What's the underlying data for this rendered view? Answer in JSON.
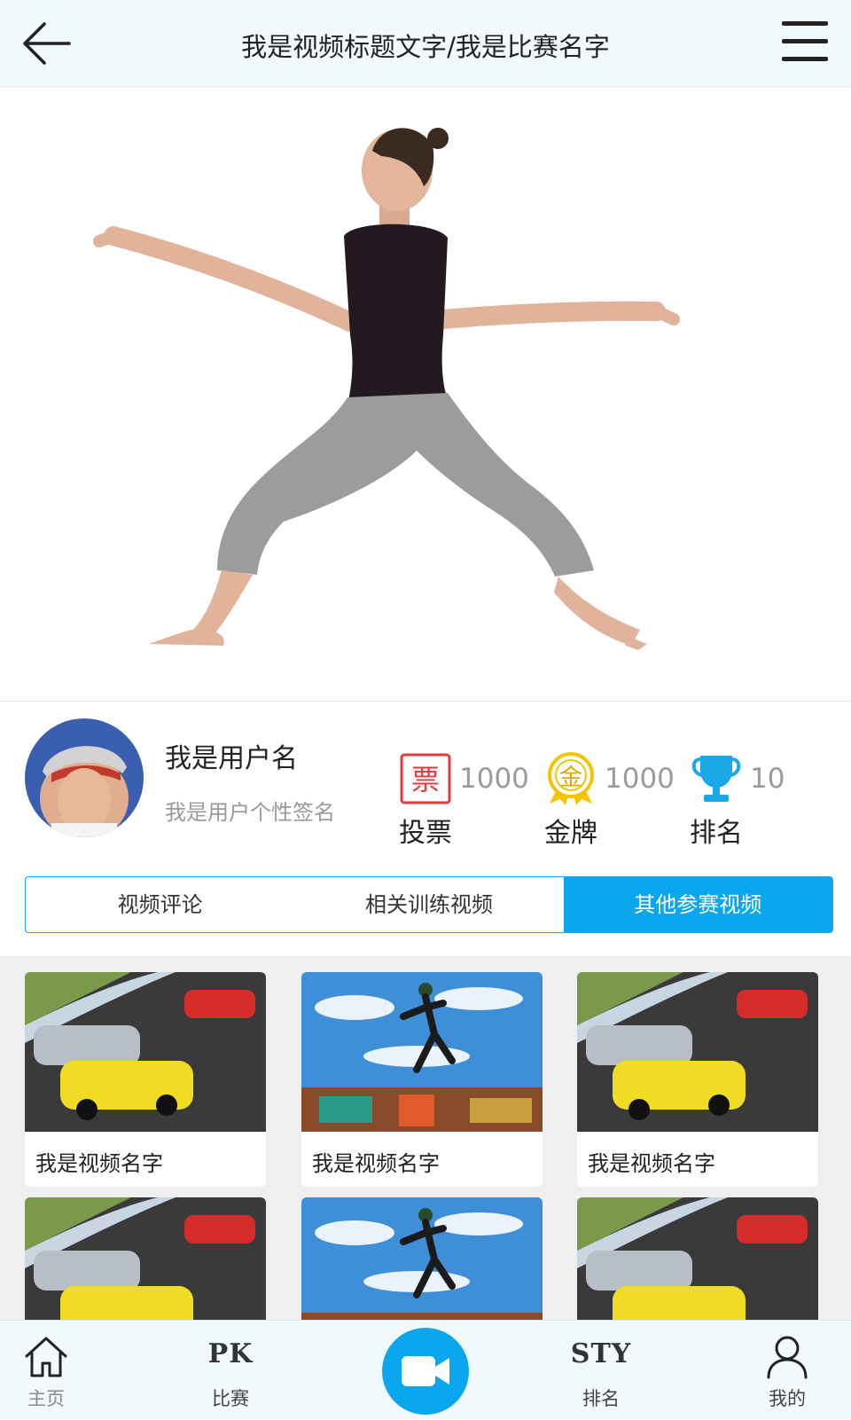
{
  "header": {
    "title": "我是视频标题文字/我是比赛名字",
    "back_icon": "arrow-left-icon",
    "menu_icon": "hamburger-menu-icon"
  },
  "user": {
    "name": "我是用户名",
    "signature": "我是用户个性签名"
  },
  "stats": [
    {
      "icon": "ticket-icon",
      "icon_text": "票",
      "value": "1000",
      "label": "投票",
      "color": "#e33b3b"
    },
    {
      "icon": "gold-medal-icon",
      "icon_text": "金",
      "value": "1000",
      "label": "金牌",
      "color": "#f5c400"
    },
    {
      "icon": "trophy-icon",
      "value": "10",
      "label": "排名",
      "color": "#1aa7e8"
    }
  ],
  "tabs": [
    {
      "label": "视频评论",
      "active": false
    },
    {
      "label": "相关训练视频",
      "active": false
    },
    {
      "label": "其他参赛视频",
      "active": true
    }
  ],
  "videos": [
    {
      "title": "我是视频名字",
      "thumb": "racing-cars"
    },
    {
      "title": "我是视频名字",
      "thumb": "street-dancer"
    },
    {
      "title": "我是视频名字",
      "thumb": "racing-cars"
    },
    {
      "title": "",
      "thumb": "racing-cars"
    },
    {
      "title": "",
      "thumb": "street-dancer"
    },
    {
      "title": "",
      "thumb": "racing-cars"
    }
  ],
  "nav": {
    "home": {
      "label": "主页",
      "icon": "home-icon"
    },
    "pk": {
      "big": "PK",
      "label": "比赛"
    },
    "record": {
      "icon": "video-camera-icon"
    },
    "sty": {
      "big": "STY",
      "label": "排名"
    },
    "mine": {
      "label": "我的",
      "icon": "user-icon"
    }
  },
  "colors": {
    "accent": "#0aa6ee",
    "header_bg": "#f1f9fd",
    "grid_bg": "#efefef"
  }
}
